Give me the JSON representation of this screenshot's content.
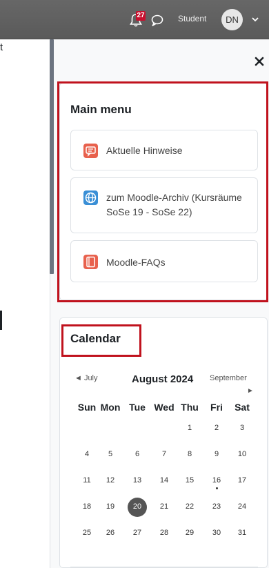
{
  "navbar": {
    "notification_count": "27",
    "user_name": "Student",
    "avatar_initials": "DN"
  },
  "page_content": {
    "edge_glyph": "t"
  },
  "drawer": {
    "close_icon": "close-icon",
    "main_menu": {
      "title": "Main menu",
      "items": [
        {
          "label": "Aktuelle Hinweise",
          "icon": "announcement-icon",
          "color": "#e8614d"
        },
        {
          "label": "zum Moodle-Archiv (Kursräume SoSe 19 - SoSe 22)",
          "icon": "globe-icon",
          "color": "#3a8fd6"
        },
        {
          "label": "Moodle-FAQs",
          "icon": "book-icon",
          "color": "#e8614d"
        }
      ]
    },
    "calendar": {
      "title": "Calendar",
      "prev_month": "◄ July",
      "current_month": "August 2024",
      "next_month": "September",
      "next_arrow": "►",
      "weekdays": [
        "Sun",
        "Mon",
        "Tue",
        "Wed",
        "Thu",
        "Fri",
        "Sat"
      ],
      "weeks": [
        [
          "",
          "",
          "",
          "",
          "1",
          "2",
          "3"
        ],
        [
          "4",
          "5",
          "6",
          "7",
          "8",
          "9",
          "10"
        ],
        [
          "11",
          "12",
          "13",
          "14",
          "15",
          "16",
          "17"
        ],
        [
          "18",
          "19",
          "20",
          "21",
          "22",
          "23",
          "24"
        ],
        [
          "25",
          "26",
          "27",
          "28",
          "29",
          "30",
          "31"
        ]
      ],
      "today": "20",
      "event_days": [
        "16"
      ]
    },
    "highlight_color": "#c0121d"
  }
}
